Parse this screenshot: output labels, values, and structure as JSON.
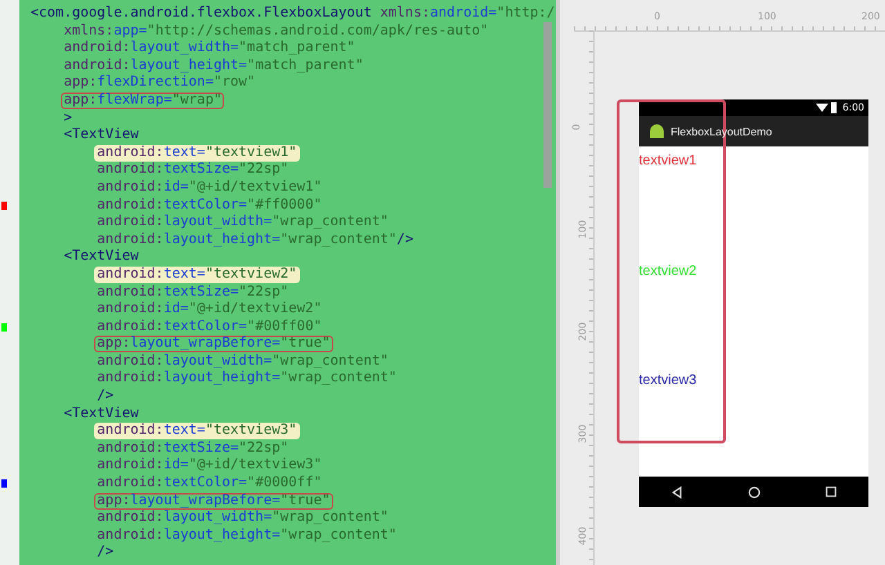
{
  "editor": {
    "lines": [
      {
        "tokens": [
          {
            "kind": "tag",
            "text": "<com.google.android.flexbox.FlexboxLayout"
          },
          {
            "kind": "prefix",
            "text": " xmlns:"
          },
          {
            "kind": "attr",
            "text": "android="
          },
          {
            "kind": "value",
            "text": "\"http:/"
          }
        ],
        "boxed": false,
        "highlighted": false,
        "children": [
          {
            "tokens": [
              {
                "kind": "prefix",
                "text": "xmlns:"
              },
              {
                "kind": "attr",
                "text": "app="
              },
              {
                "kind": "value",
                "text": "\"http://schemas.android.com/apk/res-auto\""
              }
            ],
            "boxed": false,
            "highlighted": false
          },
          {
            "tokens": [
              {
                "kind": "prefix",
                "text": "android:"
              },
              {
                "kind": "attr",
                "text": "layout_width="
              },
              {
                "kind": "value",
                "text": "\"match_parent\""
              }
            ],
            "boxed": false,
            "highlighted": false
          },
          {
            "tokens": [
              {
                "kind": "prefix",
                "text": "android:"
              },
              {
                "kind": "attr",
                "text": "layout_height="
              },
              {
                "kind": "value",
                "text": "\"match_parent\""
              }
            ],
            "boxed": false,
            "highlighted": false
          },
          {
            "tokens": [
              {
                "kind": "prefix",
                "text": "app:"
              },
              {
                "kind": "attr",
                "text": "flexDirection="
              },
              {
                "kind": "value",
                "text": "\"row\""
              }
            ],
            "boxed": false,
            "highlighted": false
          },
          {
            "tokens": [
              {
                "kind": "prefix",
                "text": "app:"
              },
              {
                "kind": "attr",
                "text": "flexWrap="
              },
              {
                "kind": "value",
                "text": "\"wrap\""
              }
            ],
            "boxed": true,
            "highlighted": false
          },
          {
            "tokens": [
              {
                "kind": "tag",
                "text": ">"
              }
            ],
            "boxed": false,
            "highlighted": false
          },
          {
            "tokens": [
              {
                "kind": "tag",
                "text": "<TextView"
              }
            ],
            "boxed": false,
            "highlighted": false,
            "children": [
              {
                "tokens": [
                  {
                    "kind": "prefix",
                    "text": "android:"
                  },
                  {
                    "kind": "attr",
                    "text": "text="
                  },
                  {
                    "kind": "value",
                    "text": "\"textview1\""
                  }
                ],
                "boxed": false,
                "highlighted": true
              },
              {
                "tokens": [
                  {
                    "kind": "prefix",
                    "text": "android:"
                  },
                  {
                    "kind": "attr",
                    "text": "textSize="
                  },
                  {
                    "kind": "value",
                    "text": "\"22sp\""
                  }
                ],
                "boxed": false,
                "highlighted": false
              },
              {
                "tokens": [
                  {
                    "kind": "prefix",
                    "text": "android:"
                  },
                  {
                    "kind": "attr",
                    "text": "id="
                  },
                  {
                    "kind": "value",
                    "text": "\"@+id/textview1\""
                  }
                ],
                "boxed": false,
                "highlighted": false
              },
              {
                "tokens": [
                  {
                    "kind": "prefix",
                    "text": "android:"
                  },
                  {
                    "kind": "attr",
                    "text": "textColor="
                  },
                  {
                    "kind": "value",
                    "text": "\"#ff0000\""
                  }
                ],
                "boxed": false,
                "highlighted": false,
                "color": "#ff0000"
              },
              {
                "tokens": [
                  {
                    "kind": "prefix",
                    "text": "android:"
                  },
                  {
                    "kind": "attr",
                    "text": "layout_width="
                  },
                  {
                    "kind": "value",
                    "text": "\"wrap_content\""
                  }
                ],
                "boxed": false,
                "highlighted": false
              },
              {
                "tokens": [
                  {
                    "kind": "prefix",
                    "text": "android:"
                  },
                  {
                    "kind": "attr",
                    "text": "layout_height="
                  },
                  {
                    "kind": "value",
                    "text": "\"wrap_content\""
                  },
                  {
                    "kind": "tag",
                    "text": "/>"
                  }
                ],
                "boxed": false,
                "highlighted": false
              }
            ]
          },
          {
            "tokens": [
              {
                "kind": "tag",
                "text": "<TextView"
              }
            ],
            "boxed": false,
            "highlighted": false,
            "children": [
              {
                "tokens": [
                  {
                    "kind": "prefix",
                    "text": "android:"
                  },
                  {
                    "kind": "attr",
                    "text": "text="
                  },
                  {
                    "kind": "value",
                    "text": "\"textview2\""
                  }
                ],
                "boxed": false,
                "highlighted": true
              },
              {
                "tokens": [
                  {
                    "kind": "prefix",
                    "text": "android:"
                  },
                  {
                    "kind": "attr",
                    "text": "textSize="
                  },
                  {
                    "kind": "value",
                    "text": "\"22sp\""
                  }
                ],
                "boxed": false,
                "highlighted": false
              },
              {
                "tokens": [
                  {
                    "kind": "prefix",
                    "text": "android:"
                  },
                  {
                    "kind": "attr",
                    "text": "id="
                  },
                  {
                    "kind": "value",
                    "text": "\"@+id/textview2\""
                  }
                ],
                "boxed": false,
                "highlighted": false
              },
              {
                "tokens": [
                  {
                    "kind": "prefix",
                    "text": "android:"
                  },
                  {
                    "kind": "attr",
                    "text": "textColor="
                  },
                  {
                    "kind": "value",
                    "text": "\"#00ff00\""
                  }
                ],
                "boxed": false,
                "highlighted": false,
                "color": "#00ff00"
              },
              {
                "tokens": [
                  {
                    "kind": "prefix",
                    "text": "app:"
                  },
                  {
                    "kind": "attr",
                    "text": "layout_wrapBefore="
                  },
                  {
                    "kind": "value",
                    "text": "\"true\""
                  }
                ],
                "boxed": true,
                "highlighted": false
              },
              {
                "tokens": [
                  {
                    "kind": "prefix",
                    "text": "android:"
                  },
                  {
                    "kind": "attr",
                    "text": "layout_width="
                  },
                  {
                    "kind": "value",
                    "text": "\"wrap_content\""
                  }
                ],
                "boxed": false,
                "highlighted": false
              },
              {
                "tokens": [
                  {
                    "kind": "prefix",
                    "text": "android:"
                  },
                  {
                    "kind": "attr",
                    "text": "layout_height="
                  },
                  {
                    "kind": "value",
                    "text": "\"wrap_content\""
                  }
                ],
                "boxed": false,
                "highlighted": false
              },
              {
                "tokens": [
                  {
                    "kind": "tag",
                    "text": "/>"
                  }
                ],
                "boxed": false,
                "highlighted": false
              }
            ]
          },
          {
            "tokens": [
              {
                "kind": "tag",
                "text": "<TextView"
              }
            ],
            "boxed": false,
            "highlighted": false,
            "children": [
              {
                "tokens": [
                  {
                    "kind": "prefix",
                    "text": "android:"
                  },
                  {
                    "kind": "attr",
                    "text": "text="
                  },
                  {
                    "kind": "value",
                    "text": "\"textview3\""
                  }
                ],
                "boxed": false,
                "highlighted": true
              },
              {
                "tokens": [
                  {
                    "kind": "prefix",
                    "text": "android:"
                  },
                  {
                    "kind": "attr",
                    "text": "textSize="
                  },
                  {
                    "kind": "value",
                    "text": "\"22sp\""
                  }
                ],
                "boxed": false,
                "highlighted": false
              },
              {
                "tokens": [
                  {
                    "kind": "prefix",
                    "text": "android:"
                  },
                  {
                    "kind": "attr",
                    "text": "id="
                  },
                  {
                    "kind": "value",
                    "text": "\"@+id/textview3\""
                  }
                ],
                "boxed": false,
                "highlighted": false
              },
              {
                "tokens": [
                  {
                    "kind": "prefix",
                    "text": "android:"
                  },
                  {
                    "kind": "attr",
                    "text": "textColor="
                  },
                  {
                    "kind": "value",
                    "text": "\"#0000ff\""
                  }
                ],
                "boxed": false,
                "highlighted": false,
                "color": "#0000ff"
              },
              {
                "tokens": [
                  {
                    "kind": "prefix",
                    "text": "app:"
                  },
                  {
                    "kind": "attr",
                    "text": "layout_wrapBefore="
                  },
                  {
                    "kind": "value",
                    "text": "\"true\""
                  }
                ],
                "boxed": true,
                "highlighted": false
              },
              {
                "tokens": [
                  {
                    "kind": "prefix",
                    "text": "android:"
                  },
                  {
                    "kind": "attr",
                    "text": "layout_width="
                  },
                  {
                    "kind": "value",
                    "text": "\"wrap_content\""
                  }
                ],
                "boxed": false,
                "highlighted": false
              },
              {
                "tokens": [
                  {
                    "kind": "prefix",
                    "text": "android:"
                  },
                  {
                    "kind": "attr",
                    "text": "layout_height="
                  },
                  {
                    "kind": "value",
                    "text": "\"wrap_content\""
                  }
                ],
                "boxed": false,
                "highlighted": false
              },
              {
                "tokens": [
                  {
                    "kind": "tag",
                    "text": "/>"
                  }
                ],
                "boxed": false,
                "highlighted": false
              }
            ]
          }
        ]
      }
    ]
  },
  "preview": {
    "top_ruler": [
      "0",
      "100",
      "200"
    ],
    "left_ruler": [
      "0",
      "100",
      "200",
      "300",
      "400"
    ],
    "phone": {
      "time": "6:00",
      "app_title": "FlexboxLayoutDemo",
      "views": [
        {
          "text": "textview1",
          "color": "#e0303a"
        },
        {
          "text": "textview2",
          "color": "#33dd33"
        },
        {
          "text": "textview3",
          "color": "#2a2aa8"
        }
      ],
      "selection_boxed": true
    }
  }
}
